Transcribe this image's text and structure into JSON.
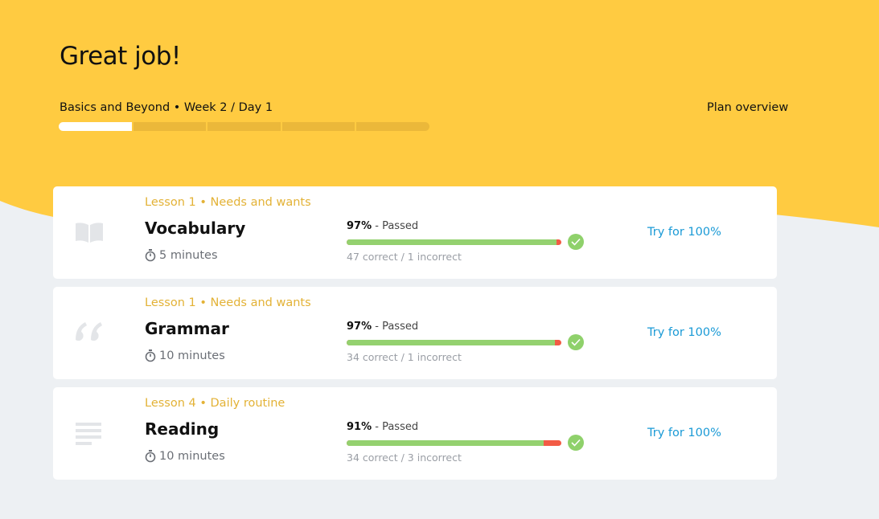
{
  "header": {
    "title": "Great job!",
    "breadcrumb": "Basics and Beyond • Week 2 / Day 1",
    "plan_link": "Plan overview",
    "day_progress": {
      "completed": 1,
      "total": 5
    }
  },
  "colors": {
    "hero": "#ffcb41",
    "background": "#edf0f3",
    "accent_link": "#1a9ad6",
    "correct": "#94d16f",
    "incorrect": "#f25b45"
  },
  "activities": [
    {
      "lesson": "Lesson 1 • Needs and wants",
      "title": "Vocabulary",
      "icon": "book-icon",
      "duration": "5 minutes",
      "percent_label": "97%",
      "status": " - Passed",
      "correct": 47,
      "incorrect": 1,
      "counts": "47 correct / 1 incorrect",
      "action": "Try for 100%"
    },
    {
      "lesson": "Lesson 1 • Needs and wants",
      "title": "Grammar",
      "icon": "quote-icon",
      "duration": "10 minutes",
      "percent_label": "97%",
      "status": " - Passed",
      "correct": 34,
      "incorrect": 1,
      "counts": "34 correct / 1 incorrect",
      "action": "Try for 100%"
    },
    {
      "lesson": "Lesson 4 • Daily routine",
      "title": "Reading",
      "icon": "text-lines-icon",
      "duration": "10 minutes",
      "percent_label": "91%",
      "status": " - Passed",
      "correct": 34,
      "incorrect": 3,
      "counts": "34 correct / 3 incorrect",
      "action": "Try for 100%"
    }
  ]
}
